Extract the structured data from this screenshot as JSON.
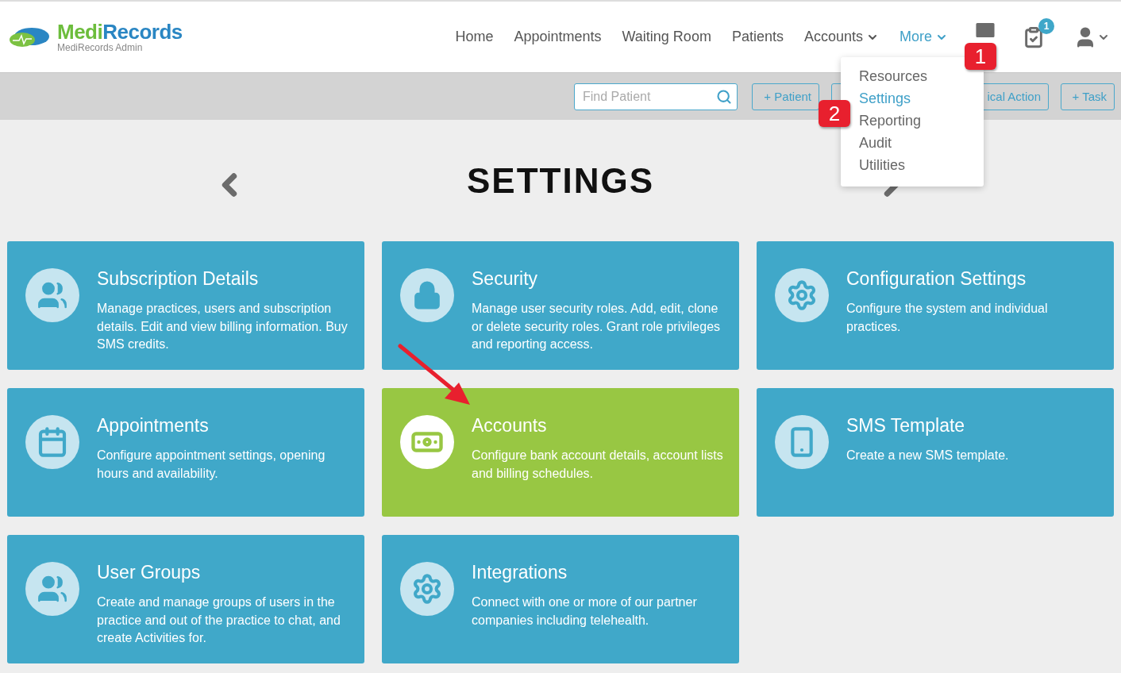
{
  "logo": {
    "name_first": "Medi",
    "name_second": "Records",
    "subtitle": "MediRecords Admin"
  },
  "nav": [
    {
      "label": "Home",
      "selected": false,
      "dropdown": false
    },
    {
      "label": "Appointments",
      "selected": false,
      "dropdown": false
    },
    {
      "label": "Waiting Room",
      "selected": false,
      "dropdown": false
    },
    {
      "label": "Patients",
      "selected": false,
      "dropdown": false
    },
    {
      "label": "Accounts",
      "selected": false,
      "dropdown": true
    },
    {
      "label": "More",
      "selected": true,
      "dropdown": true
    }
  ],
  "tasks_badge": "1",
  "more_menu": [
    {
      "label": "Resources",
      "selected": false
    },
    {
      "label": "Settings",
      "selected": true
    },
    {
      "label": "Reporting",
      "selected": false
    },
    {
      "label": "Audit",
      "selected": false
    },
    {
      "label": "Utilities",
      "selected": false
    }
  ],
  "toolbar": {
    "search": {
      "placeholder": "Find Patient"
    },
    "buttons": [
      "+ Patient",
      "ical Action",
      "+ Task"
    ]
  },
  "page_title": "SETTINGS",
  "cards": [
    {
      "kind": "people",
      "title": "Subscription Details",
      "description": "Manage practices, users and subscription details. Edit and view billing information. Buy SMS credits.",
      "highlighted": false
    },
    {
      "kind": "lock",
      "title": "Security",
      "description": "Manage user security roles. Add, edit, clone or delete security roles. Grant role privileges and reporting access.",
      "highlighted": false
    },
    {
      "kind": "gears",
      "title": "Configuration Settings",
      "description": "Configure the system and individual practices.",
      "highlighted": false
    },
    {
      "kind": "calendar",
      "title": "Appointments",
      "description": "Configure appointment settings, opening hours and availability.",
      "highlighted": false
    },
    {
      "kind": "money",
      "title": "Accounts",
      "description": "Configure bank account details, account lists and billing schedules.",
      "highlighted": true
    },
    {
      "kind": "phone",
      "title": "SMS Template",
      "description": "Create a new SMS template.",
      "highlighted": false
    },
    {
      "kind": "people",
      "title": "User Groups",
      "description": "Create and manage groups of users in the practice and out of the practice to chat, and create Activities for.",
      "highlighted": false
    },
    {
      "kind": "gears",
      "title": "Integrations",
      "description": "Connect with one or more of our partner companies including telehealth.",
      "highlighted": false
    }
  ],
  "callouts": [
    "1",
    "2"
  ]
}
